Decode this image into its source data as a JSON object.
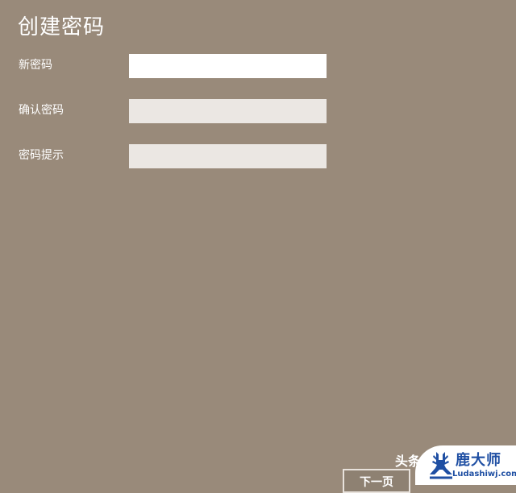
{
  "page": {
    "title": "创建密码"
  },
  "form": {
    "new_password_label": "新密码",
    "confirm_password_label": "确认密码",
    "password_hint_label": "密码提示",
    "new_password_value": "",
    "confirm_password_value": "",
    "password_hint_value": ""
  },
  "footer": {
    "next_label": "下一页",
    "watermark_prefix": "头条",
    "logo_name": "鹿大师",
    "logo_url": "Ludashiwj.com"
  },
  "colors": {
    "background": "#998a7a",
    "active_field": "#ffffff",
    "inactive_field": "#ebe7e3",
    "logo": "#1f4fa3"
  },
  "icons": {
    "logo": "deer-logo-icon"
  }
}
